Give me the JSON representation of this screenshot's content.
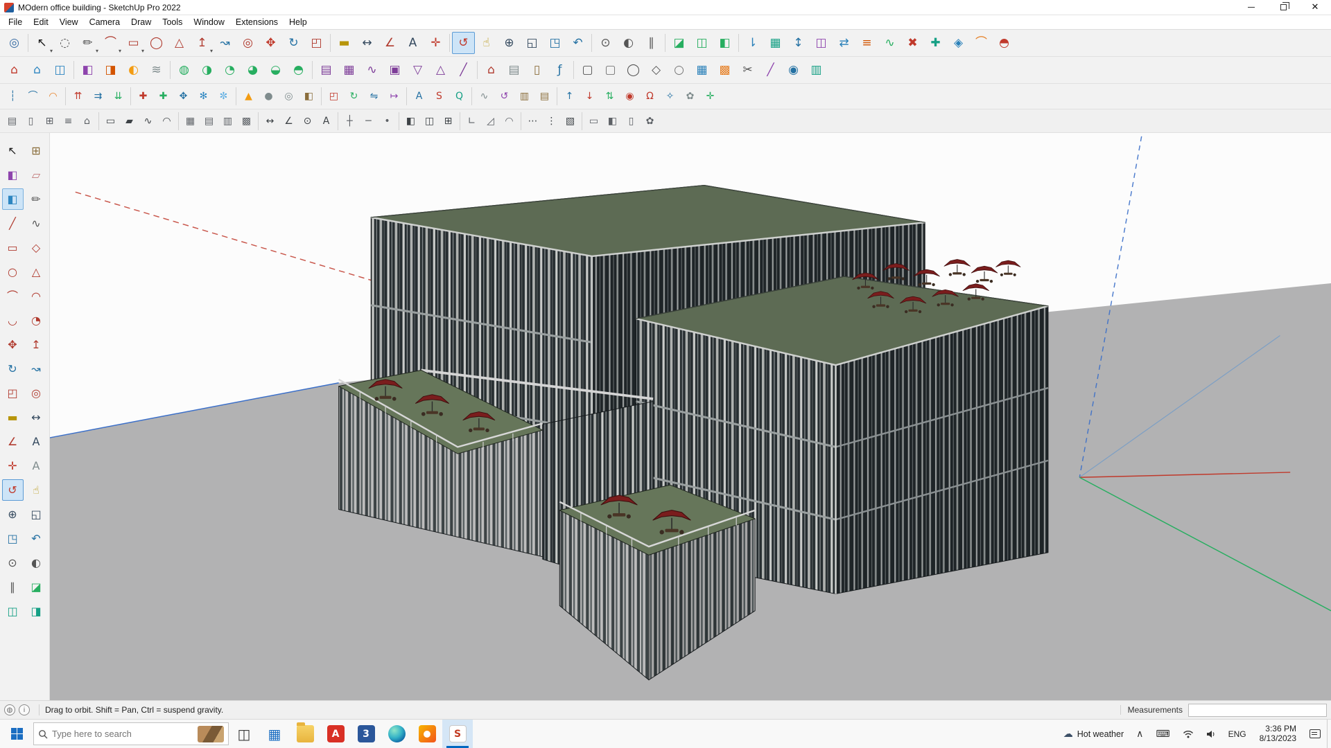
{
  "window": {
    "title": "MOdern office building - SketchUp Pro 2022"
  },
  "menu": {
    "items": [
      "File",
      "Edit",
      "View",
      "Camera",
      "Draw",
      "Tools",
      "Window",
      "Extensions",
      "Help"
    ]
  },
  "toolbars": {
    "row1": [
      {
        "n": "zoom-model-tool",
        "g": "◎",
        "c": "#3a6ea5"
      },
      {
        "s": 1
      },
      {
        "n": "select-tool",
        "g": "↖",
        "c": "#1a1a1a",
        "v": 1
      },
      {
        "n": "lasso-select-tool",
        "g": "◌",
        "c": "#555555"
      },
      {
        "n": "line-tool",
        "g": "✏",
        "c": "#4a4a4a",
        "v": 1
      },
      {
        "n": "arc-tool",
        "g": "⌒",
        "c": "#b03a2e",
        "v": 1
      },
      {
        "n": "rectangle-tool",
        "g": "▭",
        "c": "#b03a2e",
        "v": 1
      },
      {
        "n": "circle-tool",
        "g": "◯",
        "c": "#b03a2e"
      },
      {
        "n": "polygon-tool",
        "g": "△",
        "c": "#b03a2e"
      },
      {
        "n": "push-pull-tool",
        "g": "↥",
        "c": "#b03a2e",
        "v": 1
      },
      {
        "n": "follow-me-tool",
        "g": "↝",
        "c": "#2471a3"
      },
      {
        "n": "offset-tool",
        "g": "◎",
        "c": "#b03a2e"
      },
      {
        "n": "move-tool",
        "g": "✥",
        "c": "#c0392b"
      },
      {
        "n": "rotate-tool",
        "g": "↻",
        "c": "#2471a3"
      },
      {
        "n": "scale-tool",
        "g": "◰",
        "c": "#b03a2e"
      },
      {
        "s": 1
      },
      {
        "n": "tape-measure-tool",
        "g": "▬",
        "c": "#b7950b"
      },
      {
        "n": "dimension-tool",
        "g": "↔",
        "c": "#34495e"
      },
      {
        "n": "protractor-tool",
        "g": "∠",
        "c": "#b03a2e"
      },
      {
        "n": "text-tool",
        "g": "A",
        "c": "#34495e"
      },
      {
        "n": "axes-tool",
        "g": "✛",
        "c": "#c0392b"
      },
      {
        "s": 1
      },
      {
        "n": "orbit-tool",
        "g": "↺",
        "c": "#c0392b",
        "a": 1
      },
      {
        "n": "pan-tool",
        "g": "☝",
        "c": "#b7950b"
      },
      {
        "n": "zoom-tool",
        "g": "⊕",
        "c": "#34495e"
      },
      {
        "n": "zoom-window-tool",
        "g": "◱",
        "c": "#34495e"
      },
      {
        "n": "zoom-extents-tool",
        "g": "◳",
        "c": "#2471a3"
      },
      {
        "n": "previous-view-tool",
        "g": "↶",
        "c": "#2471a3"
      },
      {
        "s": 1
      },
      {
        "n": "position-camera-tool",
        "g": "⊙",
        "c": "#555555"
      },
      {
        "n": "look-around-tool",
        "g": "◐",
        "c": "#555555"
      },
      {
        "n": "walk-tool",
        "g": "∥",
        "c": "#555555"
      },
      {
        "s": 1
      },
      {
        "n": "section-plane-tool",
        "g": "◪",
        "c": "#27ae60"
      },
      {
        "n": "section-display-toggle",
        "g": "◫",
        "c": "#27ae60"
      },
      {
        "n": "section-fill-toggle",
        "g": "◧",
        "c": "#27ae60"
      },
      {
        "s": 1
      },
      {
        "n": "ext-drop-at-intersection",
        "g": "⇂",
        "c": "#2980b9"
      },
      {
        "n": "ext-smart-flatten",
        "g": "▦",
        "c": "#16a085"
      },
      {
        "n": "ext-vertical-move",
        "g": "↕",
        "c": "#2471a3"
      },
      {
        "n": "ext-mirror",
        "g": "◫",
        "c": "#8e44ad"
      },
      {
        "n": "ext-copy-array",
        "g": "⇄",
        "c": "#2980b9"
      },
      {
        "n": "ext-align",
        "g": "≡",
        "c": "#d35400"
      },
      {
        "n": "ext-weld-edges",
        "g": "∿",
        "c": "#27ae60"
      },
      {
        "n": "ext-purge",
        "g": "✖",
        "c": "#c0392b"
      },
      {
        "n": "ext-cleanup",
        "g": "✚",
        "c": "#16a085"
      },
      {
        "n": "ext-selection-toys",
        "g": "◈",
        "c": "#2980b9"
      },
      {
        "n": "ext-curvizard",
        "g": "⌒",
        "c": "#e67e22"
      },
      {
        "n": "ext-solid-inspector",
        "g": "◓",
        "c": "#c0392b"
      }
    ],
    "row2": [
      {
        "n": "3d-warehouse",
        "g": "⌂",
        "c": "#c0392b"
      },
      {
        "n": "share-model",
        "g": "⌂",
        "c": "#2e86c1"
      },
      {
        "n": "extension-warehouse",
        "g": "◫",
        "c": "#2e86c1"
      },
      {
        "s": 1
      },
      {
        "n": "material-paint",
        "g": "◧",
        "c": "#8e44ad"
      },
      {
        "n": "styles-toggle",
        "g": "◨",
        "c": "#d35400"
      },
      {
        "n": "shadows-toggle",
        "g": "◐",
        "c": "#f39c12"
      },
      {
        "n": "fog-toggle",
        "g": "≋",
        "c": "#7f8c8d"
      },
      {
        "s": 1
      },
      {
        "n": "solid-outer-shell",
        "g": "◍",
        "c": "#27ae60"
      },
      {
        "n": "solid-union",
        "g": "◑",
        "c": "#27ae60"
      },
      {
        "n": "solid-subtract",
        "g": "◔",
        "c": "#27ae60"
      },
      {
        "n": "solid-trim",
        "g": "◕",
        "c": "#27ae60"
      },
      {
        "n": "solid-intersect",
        "g": "◒",
        "c": "#27ae60"
      },
      {
        "n": "solid-split",
        "g": "◓",
        "c": "#27ae60"
      },
      {
        "s": 1
      },
      {
        "n": "sandbox-from-contours",
        "g": "▤",
        "c": "#7d3c98"
      },
      {
        "n": "sandbox-from-scratch",
        "g": "▦",
        "c": "#7d3c98"
      },
      {
        "n": "sandbox-smoove",
        "g": "∿",
        "c": "#7d3c98"
      },
      {
        "n": "sandbox-stamp",
        "g": "▣",
        "c": "#7d3c98"
      },
      {
        "n": "sandbox-drape",
        "g": "▽",
        "c": "#7d3c98"
      },
      {
        "n": "sandbox-add-detail",
        "g": "△",
        "c": "#7d3c98"
      },
      {
        "n": "sandbox-flip-edge",
        "g": "╱",
        "c": "#7d3c98"
      },
      {
        "s": 1
      },
      {
        "n": "instant-roof",
        "g": "⌂",
        "c": "#b03a2e"
      },
      {
        "n": "instant-wall",
        "g": "▤",
        "c": "#7f8c8d"
      },
      {
        "n": "instant-door",
        "g": "▯",
        "c": "#8a6d3b"
      },
      {
        "n": "jhs-powerbar",
        "g": "ƒ",
        "c": "#2471a3"
      },
      {
        "s": 1
      },
      {
        "n": "shape-rectangle",
        "g": "▢",
        "c": "#555555"
      },
      {
        "n": "shape-rounded-rectangle",
        "g": "▢",
        "c": "#777777"
      },
      {
        "n": "shape-circle",
        "g": "◯",
        "c": "#555555"
      },
      {
        "n": "shape-polygon",
        "g": "◇",
        "c": "#555555"
      },
      {
        "n": "shape-ellipse",
        "g": "○",
        "c": "#777777"
      },
      {
        "n": "grid-tool",
        "g": "▦",
        "c": "#2980b9"
      },
      {
        "n": "grid-rotated",
        "g": "▩",
        "c": "#e67e22"
      },
      {
        "n": "ext-scissors",
        "g": "✂",
        "c": "#555555"
      },
      {
        "n": "ext-knife",
        "g": "╱",
        "c": "#8e44ad"
      },
      {
        "n": "ext-hole-punch",
        "g": "◉",
        "c": "#2471a3"
      },
      {
        "n": "ext-lattice",
        "g": "▥",
        "c": "#16a085"
      }
    ],
    "row3": [
      {
        "n": "edge-tools-divide",
        "g": "┆",
        "c": "#2471a3"
      },
      {
        "n": "edge-tools-weld",
        "g": "⌒",
        "c": "#2471a3"
      },
      {
        "n": "round-corner",
        "g": "◠",
        "c": "#e67e22"
      },
      {
        "s": 1
      },
      {
        "n": "joint-push-pull",
        "g": "⇈",
        "c": "#c0392b"
      },
      {
        "n": "vector-push-pull",
        "g": "⇉",
        "c": "#2471a3"
      },
      {
        "n": "normals-push-pull",
        "g": "⇊",
        "c": "#27ae60"
      },
      {
        "s": 1
      },
      {
        "n": "add-vertex-red",
        "g": "✚",
        "c": "#c0392b"
      },
      {
        "n": "add-vertex-green",
        "g": "✚",
        "c": "#27ae60"
      },
      {
        "n": "move-vertex-blue",
        "g": "✥",
        "c": "#2471a3"
      },
      {
        "n": "freeze-snowflake",
        "g": "✻",
        "c": "#2e86c1"
      },
      {
        "n": "thaw-snowflake",
        "g": "✼",
        "c": "#5dade2"
      },
      {
        "s": 1
      },
      {
        "n": "primitive-cone",
        "g": "▲",
        "c": "#f39c12"
      },
      {
        "n": "primitive-sphere",
        "g": "●",
        "c": "#7f8c8d"
      },
      {
        "n": "primitive-tube",
        "g": "◎",
        "c": "#7f8c8d"
      },
      {
        "n": "primitive-box",
        "g": "◧",
        "c": "#8a6d3b"
      },
      {
        "s": 1
      },
      {
        "n": "fredo-scale",
        "g": "◰",
        "c": "#c0392b"
      },
      {
        "n": "fredo-rotate",
        "g": "↻",
        "c": "#27ae60"
      },
      {
        "n": "mirror-flip",
        "g": "⇋",
        "c": "#2471a3"
      },
      {
        "n": "stretch-tool",
        "g": "↦",
        "c": "#8e44ad"
      },
      {
        "s": 1
      },
      {
        "n": "label-tool",
        "g": "A",
        "c": "#2471a3"
      },
      {
        "n": "ext-letter-s",
        "g": "S",
        "c": "#c0392b"
      },
      {
        "n": "ext-letter-q",
        "g": "Q",
        "c": "#16a085"
      },
      {
        "s": 1
      },
      {
        "n": "pipe-along-path",
        "g": "∿",
        "c": "#7f8c8d"
      },
      {
        "n": "spiral-tool",
        "g": "↺",
        "c": "#8e44ad"
      },
      {
        "n": "fence-maker",
        "g": "▥",
        "c": "#8a6d3b"
      },
      {
        "n": "stair-maker",
        "g": "▤",
        "c": "#8a6d3b"
      },
      {
        "s": 1
      },
      {
        "n": "raise-arrow",
        "g": "↑",
        "c": "#2471a3"
      },
      {
        "n": "lower-arrow",
        "g": "↓",
        "c": "#c0392b"
      },
      {
        "n": "swap-tool",
        "g": "⇅",
        "c": "#27ae60"
      },
      {
        "n": "target-point",
        "g": "◉",
        "c": "#c0392b"
      },
      {
        "n": "magnet-snap",
        "g": "Ω",
        "c": "#c0392b"
      },
      {
        "n": "compass-tool",
        "g": "✧",
        "c": "#2471a3"
      },
      {
        "n": "gear-options",
        "g": "✿",
        "c": "#7f8c8d"
      },
      {
        "n": "axes-helper",
        "g": "✛",
        "c": "#27ae60"
      }
    ],
    "row4": [
      {
        "n": "arch-wall",
        "g": "▤",
        "c": "#5d6166"
      },
      {
        "n": "arch-door",
        "g": "▯",
        "c": "#5d6166"
      },
      {
        "n": "arch-window",
        "g": "⊞",
        "c": "#5d6166"
      },
      {
        "n": "arch-stair",
        "g": "≡",
        "c": "#5d6166"
      },
      {
        "n": "arch-roof",
        "g": "⌂",
        "c": "#5d6166"
      },
      {
        "s": 1
      },
      {
        "n": "frame-profile",
        "g": "▭",
        "c": "#3d4246"
      },
      {
        "n": "extrude-profile",
        "g": "▰",
        "c": "#3d4246"
      },
      {
        "n": "sweep-path",
        "g": "∿",
        "c": "#3d4246"
      },
      {
        "n": "loft-tool",
        "g": "◠",
        "c": "#3d4246"
      },
      {
        "s": 1
      },
      {
        "n": "panel-grid",
        "g": "▦",
        "c": "#5d6166"
      },
      {
        "n": "louver-horizontal",
        "g": "▤",
        "c": "#5d6166"
      },
      {
        "n": "louver-vertical",
        "g": "▥",
        "c": "#5d6166"
      },
      {
        "n": "curtain-wall",
        "g": "▩",
        "c": "#5d6166"
      },
      {
        "s": 1
      },
      {
        "n": "dim-linear",
        "g": "↔",
        "c": "#3d4246"
      },
      {
        "n": "dim-angular",
        "g": "∠",
        "c": "#3d4246"
      },
      {
        "n": "dim-radial",
        "g": "⊙",
        "c": "#3d4246"
      },
      {
        "n": "leader-text",
        "g": "A",
        "c": "#3d4246"
      },
      {
        "s": 1
      },
      {
        "n": "axis-grid",
        "g": "┼",
        "c": "#5d6166"
      },
      {
        "n": "reference-plane",
        "g": "─",
        "c": "#5d6166"
      },
      {
        "n": "reference-point",
        "g": "•",
        "c": "#5d6166"
      },
      {
        "s": 1
      },
      {
        "n": "divide-face",
        "g": "◧",
        "c": "#3d4246"
      },
      {
        "n": "split-solid",
        "g": "◫",
        "c": "#3d4246"
      },
      {
        "n": "intersect-faces",
        "g": "⊞",
        "c": "#3d4246"
      },
      {
        "s": 1
      },
      {
        "n": "corner-trim",
        "g": "∟",
        "c": "#5d6166"
      },
      {
        "n": "chamfer-edge",
        "g": "◿",
        "c": "#5d6166"
      },
      {
        "n": "fillet-edge",
        "g": "◠",
        "c": "#5d6166"
      },
      {
        "s": 1
      },
      {
        "n": "array-linear",
        "g": "⋯",
        "c": "#3d4246"
      },
      {
        "n": "array-radial",
        "g": "⋮",
        "c": "#3d4246"
      },
      {
        "n": "randomize-faces",
        "g": "▧",
        "c": "#3d4246"
      },
      {
        "s": 1
      },
      {
        "n": "export-2d",
        "g": "▭",
        "c": "#5d6166"
      },
      {
        "n": "export-3d",
        "g": "◧",
        "c": "#5d6166"
      },
      {
        "n": "print-layout",
        "g": "▯",
        "c": "#5d6166"
      },
      {
        "n": "toolbar-options-gear",
        "g": "✿",
        "c": "#5d6166"
      }
    ],
    "side": [
      {
        "n": "select-tool",
        "g": "↖",
        "c": "#1a1a1a"
      },
      {
        "n": "make-component",
        "g": "⊞",
        "c": "#8a6d3b"
      },
      {
        "n": "paint-bucket-tool",
        "g": "◧",
        "c": "#8e44ad"
      },
      {
        "n": "eraser-tool",
        "g": "▱",
        "c": "#c27a7a"
      },
      {
        "n": "component-browser",
        "g": "◧",
        "c": "#2e86c1",
        "hl": 1
      },
      {
        "n": "pencil-edit",
        "g": "✏",
        "c": "#555555"
      },
      {
        "n": "line-tool",
        "g": "╱",
        "c": "#b03a2e"
      },
      {
        "n": "freehand-tool",
        "g": "∿",
        "c": "#555555"
      },
      {
        "n": "rectangle-tool",
        "g": "▭",
        "c": "#b03a2e"
      },
      {
        "n": "rotated-rectangle-tool",
        "g": "◇",
        "c": "#b03a2e"
      },
      {
        "n": "circle-tool",
        "g": "○",
        "c": "#b03a2e"
      },
      {
        "n": "polygon-tool",
        "g": "△",
        "c": "#b03a2e"
      },
      {
        "n": "arc-tool",
        "g": "⌒",
        "c": "#b03a2e"
      },
      {
        "n": "two-point-arc-tool",
        "g": "◠",
        "c": "#b03a2e"
      },
      {
        "n": "three-point-arc-tool",
        "g": "◡",
        "c": "#b03a2e"
      },
      {
        "n": "pie-tool",
        "g": "◔",
        "c": "#b03a2e"
      },
      {
        "n": "move-tool",
        "g": "✥",
        "c": "#b03a2e"
      },
      {
        "n": "push-pull-tool",
        "g": "↥",
        "c": "#b03a2e"
      },
      {
        "n": "rotate-tool",
        "g": "↻",
        "c": "#2471a3"
      },
      {
        "n": "follow-me-tool",
        "g": "↝",
        "c": "#2471a3"
      },
      {
        "n": "scale-tool",
        "g": "◰",
        "c": "#b03a2e"
      },
      {
        "n": "offset-tool",
        "g": "◎",
        "c": "#b03a2e"
      },
      {
        "n": "tape-measure-tool",
        "g": "▬",
        "c": "#b7950b"
      },
      {
        "n": "dimension-tool",
        "g": "↔",
        "c": "#34495e"
      },
      {
        "n": "protractor-tool",
        "g": "∠",
        "c": "#b03a2e"
      },
      {
        "n": "text-tool",
        "g": "A",
        "c": "#34495e"
      },
      {
        "n": "axes-tool",
        "g": "✛",
        "c": "#c0392b"
      },
      {
        "n": "3d-text-tool",
        "g": "A",
        "c": "#7f8c8d"
      },
      {
        "n": "orbit-tool",
        "g": "↺",
        "c": "#c0392b",
        "a": 1
      },
      {
        "n": "pan-tool",
        "g": "☝",
        "c": "#b7950b"
      },
      {
        "n": "zoom-tool",
        "g": "⊕",
        "c": "#34495e"
      },
      {
        "n": "zoom-window-tool",
        "g": "◱",
        "c": "#34495e"
      },
      {
        "n": "zoom-extents-tool",
        "g": "◳",
        "c": "#2471a3"
      },
      {
        "n": "previous-view-tool",
        "g": "↶",
        "c": "#2471a3"
      },
      {
        "n": "position-camera-tool",
        "g": "⊙",
        "c": "#555555"
      },
      {
        "n": "look-around-tool",
        "g": "◐",
        "c": "#555555"
      },
      {
        "n": "walk-tool",
        "g": "∥",
        "c": "#555555"
      },
      {
        "n": "section-plane-tool",
        "g": "◪",
        "c": "#27ae60"
      },
      {
        "n": "section-display-toggle",
        "g": "◫",
        "c": "#16a085"
      },
      {
        "n": "section-fill-toggle",
        "g": "◨",
        "c": "#16a085"
      }
    ]
  },
  "statusbar": {
    "hint": "Drag to orbit. Shift = Pan, Ctrl = suspend gravity.",
    "measurements_label": "Measurements",
    "measurements_value": ""
  },
  "taskbar": {
    "search_placeholder": "Type here to search",
    "weather": "Hot weather",
    "language": "ENG",
    "time": "3:36 PM",
    "date": "8/13/2023",
    "apps": [
      {
        "n": "task-view-button",
        "kind": "glyph",
        "g": "◫",
        "fg": "#3a3a3a"
      },
      {
        "n": "widgets-app",
        "kind": "glyph",
        "g": "▦",
        "fg": "#1b6ec2"
      },
      {
        "n": "file-explorer-app",
        "kind": "folder"
      },
      {
        "n": "acrobat-app",
        "kind": "badge",
        "g": "A",
        "fg": "#ffffff",
        "bg": "#d93025"
      },
      {
        "n": "app-3",
        "kind": "badge",
        "g": "3",
        "fg": "#ffffff",
        "bg": "#2b579a"
      },
      {
        "n": "edge-app",
        "kind": "edge"
      },
      {
        "n": "photos-app",
        "kind": "photos"
      },
      {
        "n": "sketchup-app",
        "kind": "sketchup",
        "g": "S",
        "active": 1
      }
    ]
  },
  "colors": {
    "roof_green": "#5d6b54",
    "terrace_green": "#66765a",
    "facade_dark": "#272e31",
    "facade_shade": "#1e2427",
    "fin_light": "#c9cbc9",
    "umbrella_red": "#7a1d1d",
    "ground_gray": "#b2b2b3",
    "axis_red": "#c0392b",
    "axis_green": "#27ae60",
    "axis_blue": "#3b6fc9",
    "selection_blue": "#cde4f7"
  }
}
